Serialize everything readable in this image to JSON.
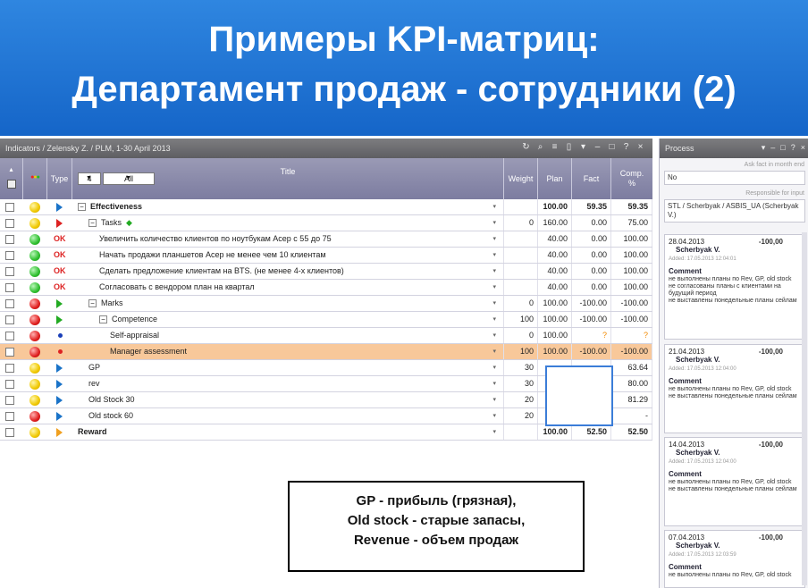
{
  "banner": {
    "line1": "Примеры KPI-матриц:",
    "line2": "Департамент продаж - сотрудники (2)"
  },
  "window": {
    "title": "Indicators / Zelensky Z. / PLM, 1-30 April 2013"
  },
  "header": {
    "type": "Type",
    "level_value": "4",
    "filter_value": "All",
    "title": "Title",
    "weight": "Weight",
    "plan": "Plan",
    "fact": "Fact",
    "comp": "Comp.",
    "comp_unit": "%"
  },
  "rows": [
    {
      "status": "yellow",
      "type": "flag-blue",
      "title": "Effectiveness",
      "expander": "⊟",
      "weight": "",
      "plan": "100.00",
      "fact": "59.35",
      "comp": "59.35",
      "bold": true
    },
    {
      "status": "yellow",
      "type": "flag-red",
      "title": "Tasks",
      "expander": "⊟",
      "star": "◆",
      "weight": "0",
      "plan": "160.00",
      "fact": "0.00",
      "comp": "75.00"
    },
    {
      "status": "green",
      "type": "ok",
      "title": "Увеличить количество клиентов по ноутбукам Асер с 55 до 75",
      "weight": "",
      "plan": "40.00",
      "fact": "0.00",
      "comp": "100.00"
    },
    {
      "status": "green",
      "type": "ok",
      "title": "Начать продажи планшетов Асер не менее чем 10 клиентам",
      "weight": "",
      "plan": "40.00",
      "fact": "0.00",
      "comp": "100.00"
    },
    {
      "status": "green",
      "type": "ok",
      "title": "Сделать предложение клиентам на BTS. (не менее 4-х клиентов)",
      "weight": "",
      "plan": "40.00",
      "fact": "0.00",
      "comp": "100.00"
    },
    {
      "status": "green",
      "type": "ok",
      "title": "Согласовать с вендором план на квартал",
      "weight": "",
      "plan": "40.00",
      "fact": "0.00",
      "comp": "100.00"
    },
    {
      "status": "red",
      "type": "flag-green",
      "title": "Marks",
      "expander": "⊟",
      "weight": "0",
      "plan": "100.00",
      "fact": "-100.00",
      "comp": "-100.00"
    },
    {
      "status": "red",
      "type": "flag-green",
      "title": "Competence",
      "expander": "⊟",
      "weight": "100",
      "plan": "100.00",
      "fact": "-100.00",
      "comp": "-100.00"
    },
    {
      "status": "red",
      "type": "dot-blue",
      "title": "Self-appraisal",
      "weight": "0",
      "plan": "100.00",
      "fact": "?",
      "comp": "?"
    },
    {
      "status": "red",
      "type": "dot-red",
      "title": "Manager assessment",
      "weight": "100",
      "plan": "100.00",
      "fact": "-100.00",
      "comp": "-100.00",
      "selected": true
    },
    {
      "status": "yellow",
      "type": "flag-blue",
      "title": "GP",
      "weight": "30",
      "plan": "",
      "fact": "",
      "comp": "63.64"
    },
    {
      "status": "yellow",
      "type": "flag-blue",
      "title": "rev",
      "weight": "30",
      "plan": "",
      "fact": "",
      "comp": "80.00"
    },
    {
      "status": "yellow",
      "type": "flag-blue",
      "title": "Old Stock 30",
      "weight": "20",
      "plan": "",
      "fact": "",
      "comp": "81.29"
    },
    {
      "status": "red",
      "type": "flag-blue",
      "title": "Old stock 60",
      "weight": "20",
      "plan": "",
      "fact": "",
      "comp": "-"
    },
    {
      "status": "yellow",
      "type": "flag-orange",
      "title": "Reward",
      "weight": "",
      "plan": "100.00",
      "fact": "52.50",
      "comp": "52.50",
      "bold": true
    }
  ],
  "note": {
    "line1": "GP - прибыль (грязная),",
    "line2": "Old stock - старые запасы,",
    "line3": "Revenue - объем продаж"
  },
  "process": {
    "title": "Process",
    "ask_label": "Ask fact in month end",
    "ask_value": "No",
    "responsible_label": "Responsible for input",
    "responsible_value": "STL / Scherbyak / ASBIS_UA (Scherbyak V.)",
    "entries": [
      {
        "date": "28.04.2013",
        "amount": "-100,00",
        "author": "Scherbyak V.",
        "added": "Added: 17.05.2013 12:04:01",
        "comment_label": "Comment",
        "comment": "не выполнены планы по Rev, GP, old stock\nне согласованы планы с клиентами на будущий период\nне выставлены понедельные планы сейлам"
      },
      {
        "date": "21.04.2013",
        "amount": "-100,00",
        "author": "Scherbyak V.",
        "added": "Added: 17.05.2013 12:04:00",
        "comment_label": "Comment",
        "comment": "не выполнены планы по Rev, GP, old stock\nне выставлены понедельные планы сейлам"
      },
      {
        "date": "14.04.2013",
        "amount": "-100,00",
        "author": "Scherbyak V.",
        "added": "Added: 17.05.2013 12:04:00",
        "comment_label": "Comment",
        "comment": "не выполнены планы по Rev, GP, old stock\nне выставлены понедельные планы сейлам"
      },
      {
        "date": "07.04.2013",
        "amount": "-100,00",
        "author": "Scherbyak V.",
        "added": "Added: 17.05.2013 12:03:59",
        "comment_label": "Comment",
        "comment": "не выполнены планы по Rev, GP, old stock"
      }
    ]
  },
  "colors": {
    "banner": "#1f72d6",
    "header": "#8a8aab",
    "selected_row": "#f8c89a",
    "popup_border": "#3b7dd8"
  }
}
